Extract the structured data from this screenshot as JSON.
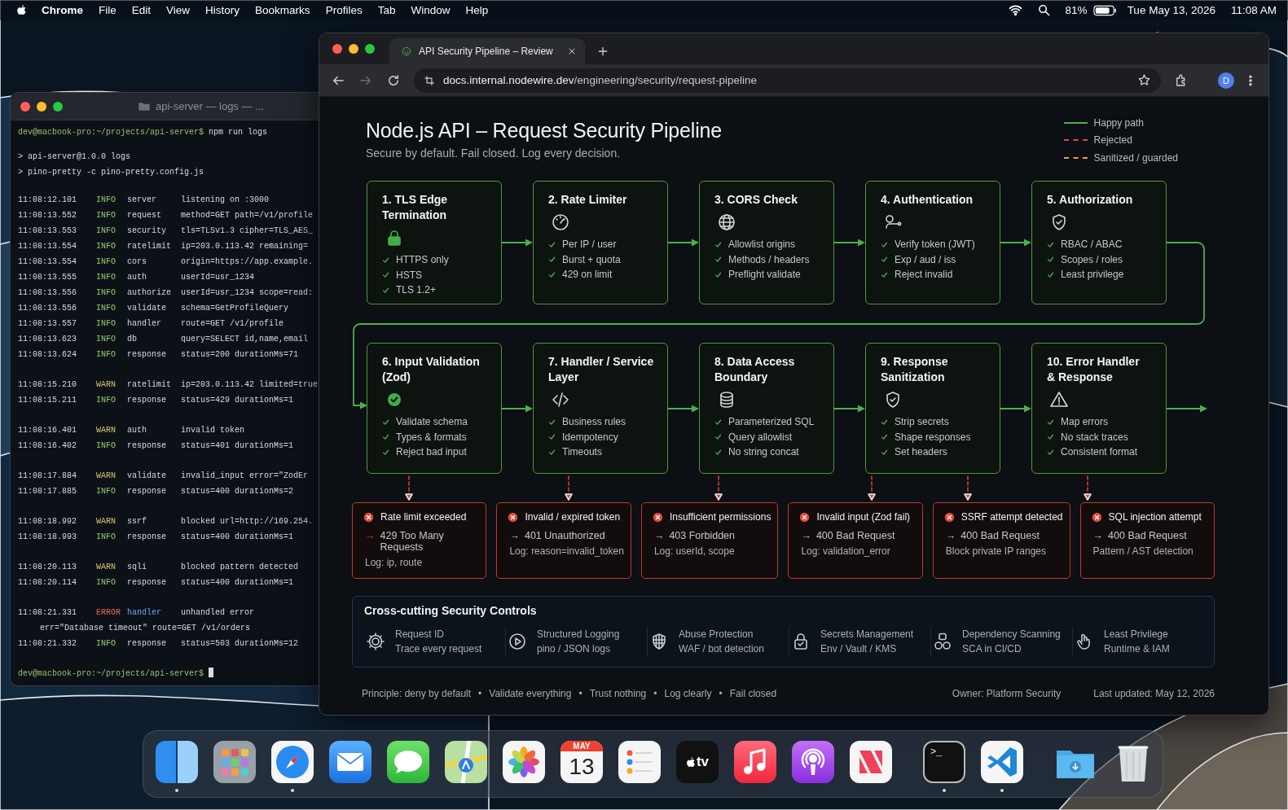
{
  "menubar": {
    "app": "Chrome",
    "menus": [
      "File",
      "Edit",
      "View",
      "History",
      "Bookmarks",
      "Profiles",
      "Tab",
      "Window",
      "Help"
    ],
    "battery": "81%",
    "date": "Tue May 13, 2026",
    "time": "11:08 AM"
  },
  "terminal": {
    "title": "api-server — logs — ...",
    "prompt": "dev@macbook-pro:~/projects/api-server$",
    "command": "npm run logs",
    "output": [
      "> api-server@1.0.0 logs",
      "> pino-pretty -c pino-pretty.config.js"
    ],
    "log_groups": [
      [
        {
          "time": "11:08:12.101",
          "level": "INFO",
          "module": "server",
          "message": "listening on :3000"
        },
        {
          "time": "11:08:13.552",
          "level": "INFO",
          "module": "request",
          "message": "method=GET path=/v1/profile"
        },
        {
          "time": "11:08:13.553",
          "level": "INFO",
          "module": "security",
          "message": "tls=TLSv1.3 cipher=TLS_AES_"
        },
        {
          "time": "11:08:13.554",
          "level": "INFO",
          "module": "ratelimit",
          "message": "ip=203.0.113.42 remaining="
        },
        {
          "time": "11:08:13.554",
          "level": "INFO",
          "module": "cors",
          "message": "origin=https://app.example."
        },
        {
          "time": "11:08:13.555",
          "level": "INFO",
          "module": "auth",
          "message": "userId=usr_1234"
        },
        {
          "time": "11:08:13.556",
          "level": "INFO",
          "module": "authorize",
          "message": "userId=usr_1234 scope=read:"
        },
        {
          "time": "11:08:13.556",
          "level": "INFO",
          "module": "validate",
          "message": "schema=GetProfileQuery"
        },
        {
          "time": "11:08:13.557",
          "level": "INFO",
          "module": "handler",
          "message": "route=GET /v1/profile"
        },
        {
          "time": "11:08:13.623",
          "level": "INFO",
          "module": "db",
          "message": "query=SELECT id,name,email"
        },
        {
          "time": "11:08:13.624",
          "level": "INFO",
          "module": "response",
          "message": "status=200 durationMs=71"
        }
      ],
      [
        {
          "time": "11:08:15.210",
          "level": "WARN",
          "module": "ratelimit",
          "message": "ip=203.0.113.42 limited=true"
        },
        {
          "time": "11:08:15.211",
          "level": "INFO",
          "module": "response",
          "message": "status=429 durationMs=1"
        }
      ],
      [
        {
          "time": "11:08:16.401",
          "level": "WARN",
          "module": "auth",
          "message": "invalid token"
        },
        {
          "time": "11:08:16.402",
          "level": "INFO",
          "module": "response",
          "message": "status=401 durationMs=1"
        }
      ],
      [
        {
          "time": "11:08:17.884",
          "level": "WARN",
          "module": "validate",
          "message": "invalid_input error=\"ZodEr"
        },
        {
          "time": "11:08:17.885",
          "level": "INFO",
          "module": "response",
          "message": "status=400 durationMs=2"
        }
      ],
      [
        {
          "time": "11:08:18.992",
          "level": "WARN",
          "module": "ssrf",
          "message": "blocked url=http://169.254."
        },
        {
          "time": "11:08:18.993",
          "level": "INFO",
          "module": "response",
          "message": "status=400 durationMs=1"
        }
      ],
      [
        {
          "time": "11:08:20.113",
          "level": "WARN",
          "module": "sqli",
          "message": "blocked pattern detected"
        },
        {
          "time": "11:08:20.114",
          "level": "INFO",
          "module": "response",
          "message": "status=400 durationMs=1"
        }
      ],
      [
        {
          "time": "11:08:21.331",
          "level": "ERROR",
          "module": "handler",
          "message": "unhandled error",
          "continuation": "err=\"Database timeout\" route=GET /v1/orders"
        },
        {
          "time": "11:08:21.332",
          "level": "INFO",
          "module": "response",
          "message": "status=503 durationMs=12"
        }
      ]
    ],
    "final_prompt": "dev@macbook-pro:~/projects/api-server$"
  },
  "browser": {
    "tab_title": "API Security Pipeline – Review",
    "forward_disabled": true,
    "url_host": "docs.internal.nodewire.dev",
    "url_path": "/engineering/security/request-pipeline",
    "avatar": "D"
  },
  "page": {
    "title": "Node.js API – Request Security Pipeline",
    "subtitle": "Secure by default. Fail closed. Log every decision.",
    "legend": [
      {
        "label": "Happy path",
        "color": "#4caf50"
      },
      {
        "label": "Rejected",
        "color": "#e0463a"
      },
      {
        "label": "Sanitized / guarded",
        "color": "#f0a030"
      }
    ],
    "stages": [
      {
        "title_lines": [
          "1.  TLS Edge",
          "Termination"
        ],
        "checks": [
          "HTTPS only",
          "HSTS",
          "TLS 1.2+"
        ]
      },
      {
        "title_lines": [
          "2. Rate Limiter"
        ],
        "checks": [
          "Per IP / user",
          "Burst + quota",
          "429 on limit"
        ]
      },
      {
        "title_lines": [
          "3. CORS Check"
        ],
        "checks": [
          "Allowlist origins",
          "Methods / headers",
          "Preflight validate"
        ]
      },
      {
        "title_lines": [
          "4. Authentication"
        ],
        "checks": [
          "Verify token (JWT)",
          "Exp / aud / iss",
          "Reject invalid"
        ]
      },
      {
        "title_lines": [
          "5. Authorization"
        ],
        "checks": [
          "RBAC / ABAC",
          "Scopes / roles",
          "Least privilege"
        ]
      },
      {
        "title_lines": [
          "6. Input Validation",
          "(Zod)"
        ],
        "checks": [
          "Validate schema",
          "Types & formats",
          "Reject bad input"
        ]
      },
      {
        "title_lines": [
          "7. Handler / Service",
          "Layer"
        ],
        "checks": [
          "Business rules",
          "Idempotency",
          "Timeouts"
        ]
      },
      {
        "title_lines": [
          "8. Data Access",
          "Boundary"
        ],
        "checks": [
          "Parameterized SQL",
          "Query allowlist",
          "No string concat"
        ]
      },
      {
        "title_lines": [
          "9. Response",
          "Sanitization"
        ],
        "checks": [
          "Strip secrets",
          "Shape responses",
          "Set headers"
        ]
      },
      {
        "title_lines": [
          "10. Error Handler",
          "& Response"
        ],
        "checks": [
          "Map errors",
          "No stack traces",
          "Consistent format"
        ]
      }
    ],
    "rejections": [
      {
        "title": "Rate limit exceeded",
        "arrow": "→",
        "arrow_emphasis": true,
        "status": "429 Too Many Requests",
        "detail": "Log: ip, route"
      },
      {
        "title": "Invalid / expired token",
        "arrow": "→",
        "arrow_emphasis": false,
        "status": "401 Unauthorized",
        "detail": "Log: reason=invalid_token"
      },
      {
        "title": "Insufficient permissions",
        "arrow": "→",
        "arrow_emphasis": false,
        "status": "403 Forbidden",
        "detail": "Log: userId, scope"
      },
      {
        "title": "Invalid input (Zod fail)",
        "arrow": "→",
        "arrow_emphasis": false,
        "status": "400 Bad Request",
        "detail": "Log: validation_error"
      },
      {
        "title": "SSRF attempt detected",
        "arrow": "→",
        "arrow_emphasis": false,
        "status": "400 Bad Request",
        "detail": "Block private IP ranges"
      },
      {
        "title": "SQL injection attempt",
        "arrow": "→",
        "arrow_emphasis": false,
        "status": "400 Bad Request",
        "detail": "Pattern / AST detection"
      }
    ],
    "controls": {
      "title": "Cross-cutting Security Controls",
      "items": [
        {
          "name": "Request ID",
          "detail": "Trace every request"
        },
        {
          "name": "Structured Logging",
          "detail": "pino / JSON logs"
        },
        {
          "name": "Abuse Protection",
          "detail": "WAF / bot detection"
        },
        {
          "name": "Secrets Management",
          "detail": "Env / Vault / KMS"
        },
        {
          "name": "Dependency Scanning",
          "detail": "SCA in CI/CD"
        },
        {
          "name": "Least Privilege",
          "detail": "Runtime & IAM"
        }
      ]
    },
    "footer": {
      "principles": [
        "Principle: deny by default",
        "Validate everything",
        "Trust nothing",
        "Log clearly",
        "Fail closed"
      ],
      "separator": "•",
      "owner": "Owner: Platform Security",
      "updated": "Last updated: May 12, 2026"
    }
  },
  "dock": [
    {
      "kind": "finder",
      "running": true
    },
    {
      "kind": "launchpad",
      "running": false
    },
    {
      "kind": "safari",
      "running": true
    },
    {
      "kind": "mail",
      "running": false
    },
    {
      "kind": "messages",
      "running": false
    },
    {
      "kind": "maps",
      "running": false
    },
    {
      "kind": "photos",
      "running": false
    },
    {
      "kind": "calendar",
      "running": false,
      "month": "MAY",
      "day": "13"
    },
    {
      "kind": "reminders",
      "running": false
    },
    {
      "kind": "tv",
      "running": false,
      "label": "tv"
    },
    {
      "kind": "music",
      "running": false
    },
    {
      "kind": "podcasts",
      "running": false
    },
    {
      "kind": "news",
      "running": false
    },
    {
      "kind": "separator"
    },
    {
      "kind": "terminal",
      "running": true,
      "label": ">_"
    },
    {
      "kind": "vscode",
      "running": true
    },
    {
      "kind": "separator"
    },
    {
      "kind": "downloads",
      "running": false
    },
    {
      "kind": "trash",
      "running": false
    }
  ]
}
